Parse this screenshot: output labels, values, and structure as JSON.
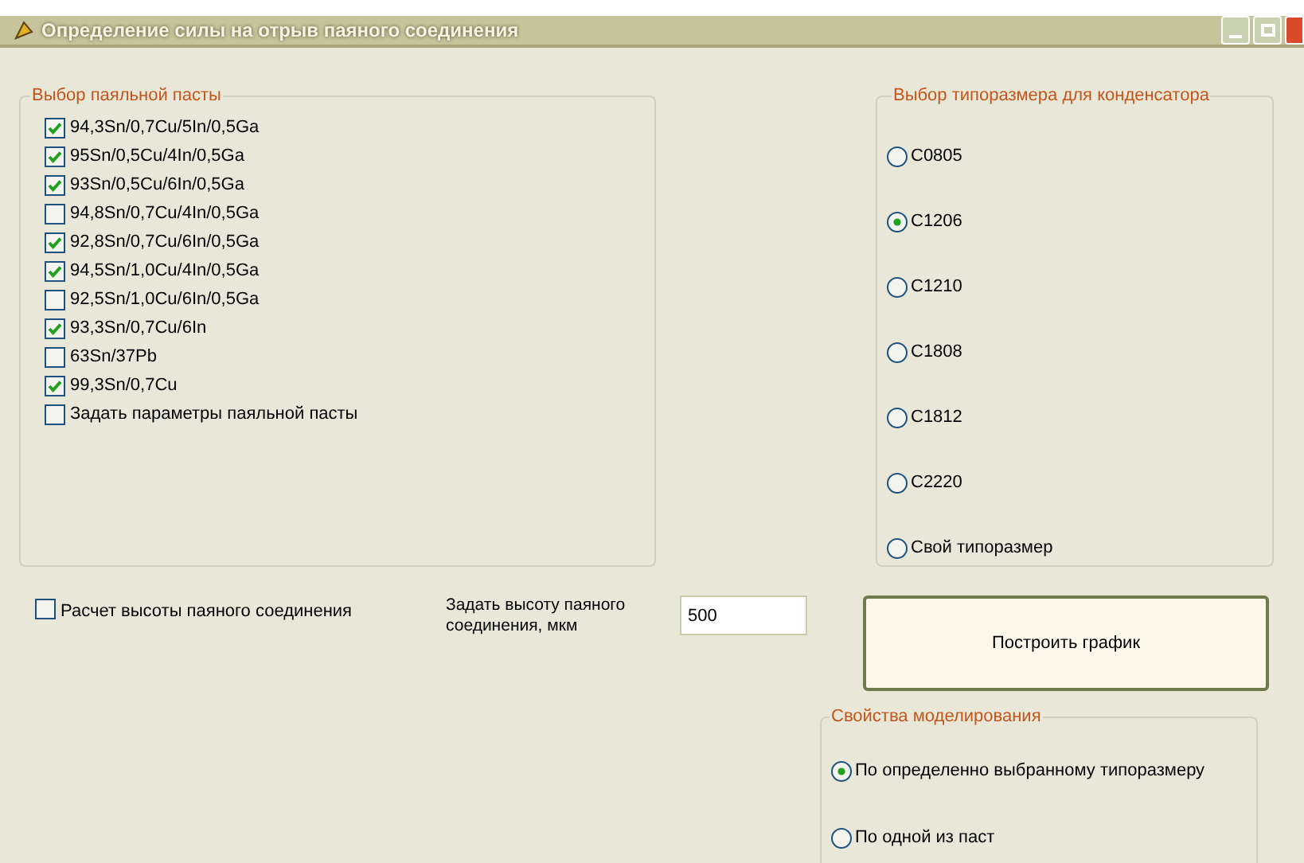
{
  "window": {
    "title": "Определение силы на отрыв паяного соединения"
  },
  "paste_group": {
    "legend": "Выбор паяльной пасты",
    "items": [
      {
        "label": "94,3Sn/0,7Cu/5In/0,5Ga",
        "checked": true
      },
      {
        "label": "95Sn/0,5Cu/4In/0,5Ga",
        "checked": true
      },
      {
        "label": "93Sn/0,5Cu/6In/0,5Ga",
        "checked": true
      },
      {
        "label": "94,8Sn/0,7Cu/4In/0,5Ga",
        "checked": false
      },
      {
        "label": "92,8Sn/0,7Cu/6In/0,5Ga",
        "checked": true
      },
      {
        "label": "94,5Sn/1,0Cu/4In/0,5Ga",
        "checked": true
      },
      {
        "label": "92,5Sn/1,0Cu/6In/0,5Ga",
        "checked": false
      },
      {
        "label": "93,3Sn/0,7Cu/6In",
        "checked": true
      },
      {
        "label": "63Sn/37Pb",
        "checked": false
      },
      {
        "label": "99,3Sn/0,7Cu",
        "checked": true
      },
      {
        "label": "Задать параметры паяльной пасты",
        "checked": false
      }
    ]
  },
  "size_group": {
    "legend": "Выбор типоразмера для конденсатора",
    "options": [
      {
        "label": "C0805",
        "selected": false
      },
      {
        "label": "C1206",
        "selected": true
      },
      {
        "label": "C1210",
        "selected": false
      },
      {
        "label": "C1808",
        "selected": false
      },
      {
        "label": "C1812",
        "selected": false
      },
      {
        "label": "C2220",
        "selected": false
      },
      {
        "label": "Свой типоразмер",
        "selected": false
      }
    ]
  },
  "height_calc": {
    "label": "Расчет высоты паяного соединения",
    "checked": false
  },
  "height_input": {
    "label": "Задать высоту паяного соединения, мкм",
    "value": "500"
  },
  "plot_button": "Построить график",
  "modeling_group": {
    "legend": "Свойства моделирования",
    "options": [
      {
        "label": "По определенно выбранному типоразмеру",
        "selected": true
      },
      {
        "label": "По одной из паст",
        "selected": false
      }
    ]
  }
}
